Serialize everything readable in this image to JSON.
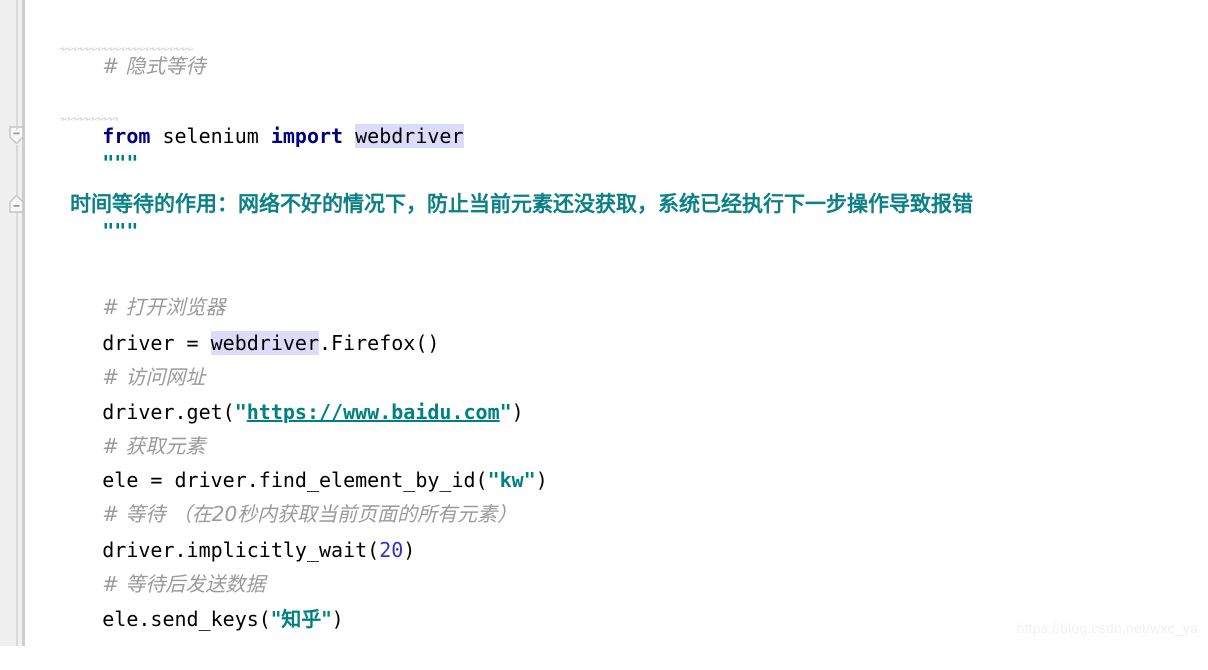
{
  "editor": {
    "language": "Python",
    "background_color": "#ffffff",
    "gutter_color": "#f0f0f0",
    "gutter_border_color": "#cdcdcd"
  },
  "colors": {
    "keyword": "#000080",
    "comment": "#9a9a9a",
    "string": "#008080",
    "docstring_text": "#0c8087",
    "number": "#3333cc",
    "identifier_highlight": "#dcdcfa",
    "squiggle": "#c9c9d4",
    "watermark": "#f1f1f1"
  },
  "gutter": {
    "fold_start": {
      "name": "fold-region-start",
      "sign": "−"
    },
    "fold_end": {
      "name": "fold-region-end",
      "sign": "−"
    }
  },
  "code": {
    "line1_comment": "# 隐式等待",
    "line3": {
      "kw_from": "from",
      "module": " selenium ",
      "kw_import": "import",
      "space": " ",
      "name": "webdriver"
    },
    "line4_docquote": "\"\"\"",
    "line5_doctext": "时间等待的作用：网络不好的情况下，防止当前元素还没获取，系统已经执行下一步操作导致报错",
    "line6_docquote": "\"\"\"",
    "line8_comment": "# 打开浏览器",
    "line9": {
      "prefix": "driver = ",
      "highlighted": "webdriver",
      "suffix": ".Firefox()"
    },
    "line10_comment": "# 访问网址",
    "line11": {
      "prefix": "driver.get(",
      "quote_open": "\"",
      "url": "https://www.baidu.com",
      "quote_close": "\"",
      "suffix": ")"
    },
    "line12_comment": "# 获取元素",
    "line13": {
      "prefix": "ele = driver.find_element_by_id(",
      "string": "\"kw\"",
      "suffix": ")"
    },
    "line14_comment": "# 等待 （在20秒内获取当前页面的所有元素）",
    "line15": {
      "prefix": "driver.implicitly_wait(",
      "number": "20",
      "suffix": ")"
    },
    "line16_comment": "# 等待后发送数据",
    "line17": {
      "prefix": "ele.send_keys(",
      "string": "\"知乎\"",
      "suffix": ")"
    }
  },
  "watermark": {
    "text": "https://blog.csdn.net/wxc_ya"
  }
}
